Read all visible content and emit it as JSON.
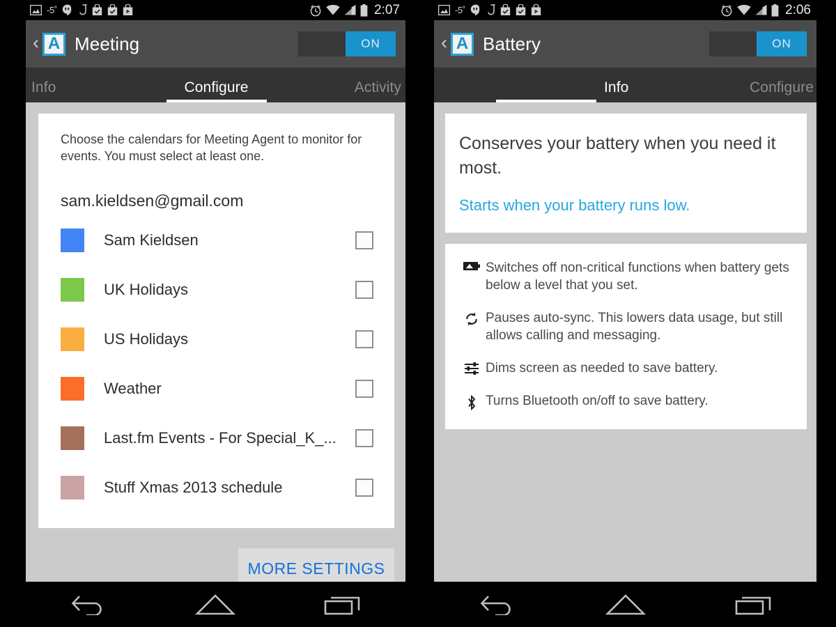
{
  "statusbar": {
    "icons_left": [
      "image-icon",
      "temperature-label",
      "hangouts-icon",
      "music-note-icon",
      "checkbox-bag-icon",
      "checkbox-bag-icon",
      "play-bag-icon"
    ],
    "temperature": "-5˚",
    "icons_right": [
      "alarm-clock-icon",
      "wifi-icon",
      "signal-icon",
      "battery-icon"
    ],
    "time_left": "2:07",
    "time_right": "2:06"
  },
  "colors": {
    "accent_blue": "#29a6e0",
    "toggle_on": "#1a93cd",
    "link_blue": "#1671d8",
    "actionbar": "#4b4b4b",
    "tabbar": "#333333",
    "body_gray": "#cbcbcb"
  },
  "left_screen": {
    "app_icon_letter": "A",
    "title": "Meeting",
    "toggle_label": "ON",
    "tabs": [
      {
        "label": "Info",
        "active": false
      },
      {
        "label": "Configure",
        "active": true
      },
      {
        "label": "Activity",
        "active": false
      }
    ],
    "intro_text": "Choose the calendars for Meeting Agent to monitor for events. You must select at least one.",
    "account": "sam.kieldsen@gmail.com",
    "calendars": [
      {
        "name": "Sam Kieldsen",
        "color": "#4285f4",
        "checked": false
      },
      {
        "name": "UK Holidays",
        "color": "#7bc84b",
        "checked": false
      },
      {
        "name": "US Holidays",
        "color": "#fbae40",
        "checked": false
      },
      {
        "name": "Weather",
        "color": "#fa6e2a",
        "checked": false
      },
      {
        "name": "Last.fm Events - For Special_K_...",
        "color": "#a5705c",
        "checked": false
      },
      {
        "name": "Stuff Xmas 2013 schedule",
        "color": "#c9a3a6",
        "checked": false
      }
    ],
    "more_settings_label": "MORE SETTINGS"
  },
  "right_screen": {
    "app_icon_letter": "A",
    "title": "Battery",
    "toggle_label": "ON",
    "tabs": [
      {
        "label": "Info",
        "active": true
      },
      {
        "label": "Configure",
        "active": false
      }
    ],
    "hero_text": "Conserves your battery when you need it most.",
    "hero_link": "Starts when your battery runs low.",
    "features": [
      {
        "icon": "battery-icon",
        "text": "Switches off non-critical functions when battery gets below a level that you set."
      },
      {
        "icon": "sync-icon",
        "text": "Pauses auto-sync. This lowers data usage, but still allows calling and messaging."
      },
      {
        "icon": "sliders-icon",
        "text": "Dims screen as needed to save battery."
      },
      {
        "icon": "bluetooth-icon",
        "text": "Turns Bluetooth on/off to save battery."
      }
    ]
  },
  "navbar": {
    "buttons": [
      "back-icon",
      "home-icon",
      "recents-icon"
    ]
  }
}
